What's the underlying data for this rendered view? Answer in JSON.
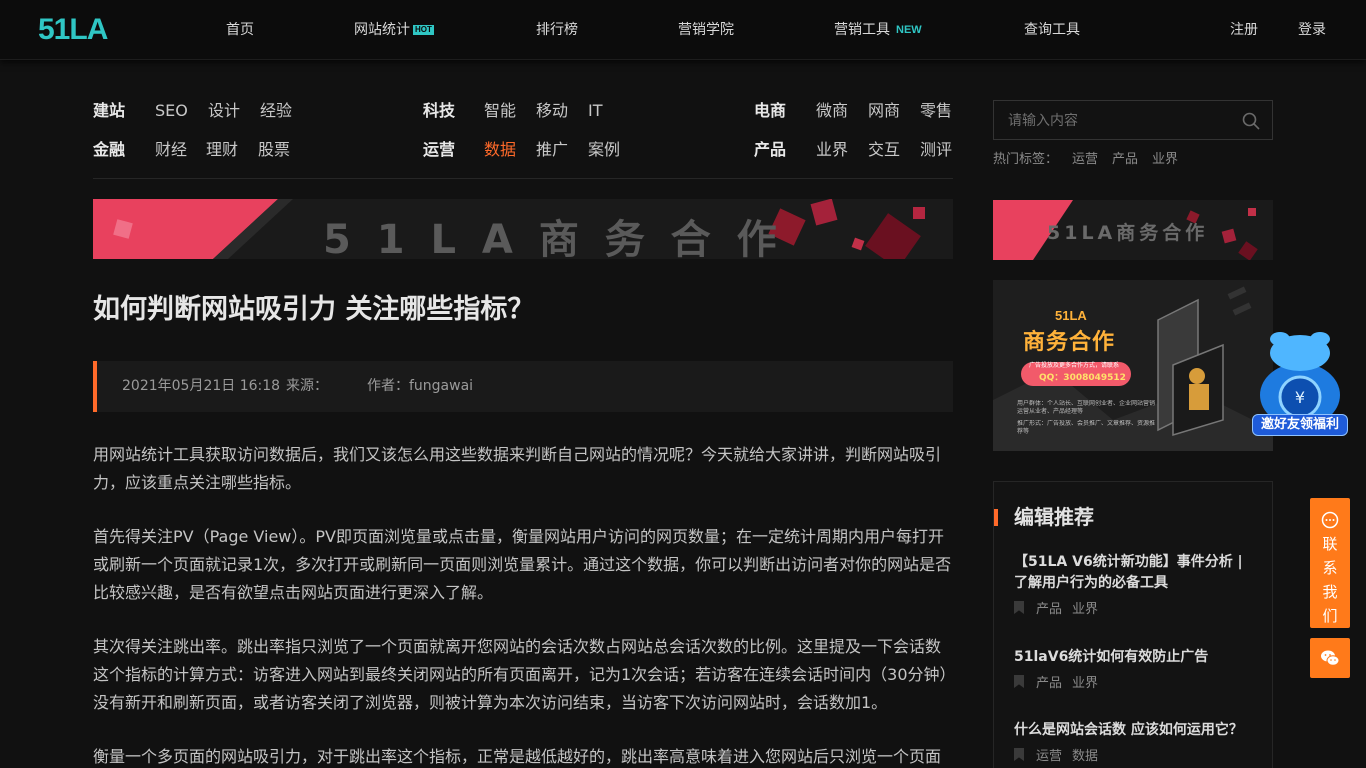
{
  "brand": {
    "logo": "51LA",
    "accent": "#2fc6c4",
    "highlight": "#ff6a2a"
  },
  "nav": {
    "items": [
      {
        "label": "首页"
      },
      {
        "label": "网站统计",
        "badge": "HOT"
      },
      {
        "label": "排行榜"
      },
      {
        "label": "营销学院"
      },
      {
        "label": "营销工具",
        "badge": "NEW"
      },
      {
        "label": "查询工具"
      }
    ],
    "register": "注册",
    "login": "登录"
  },
  "categories": {
    "build": {
      "head": "建站",
      "items": [
        "SEO",
        "设计",
        "经验"
      ]
    },
    "finance": {
      "head": "金融",
      "items": [
        "财经",
        "理财",
        "股票"
      ]
    },
    "tech": {
      "head": "科技",
      "items": [
        "智能",
        "移动",
        "IT"
      ]
    },
    "ops": {
      "head": "运营",
      "items": [
        "数据",
        "推广",
        "案例"
      ],
      "active": "数据"
    },
    "ecom": {
      "head": "电商",
      "items": [
        "微商",
        "网商",
        "零售"
      ]
    },
    "product": {
      "head": "产品",
      "items": [
        "业界",
        "交互",
        "测评"
      ]
    }
  },
  "banners": {
    "main": "5 1 L A 商 务 合 作",
    "side": "51LA商务合作"
  },
  "article": {
    "title": "如何判断网站吸引力 关注哪些指标？",
    "date": "2021年05月21日 16:18",
    "source_label": "来源：",
    "author_label": "作者：fungawai",
    "paragraphs": [
      "用网站统计工具获取访问数据后，我们又该怎么用这些数据来判断自己网站的情况呢？今天就给大家讲讲，判断网站吸引力，应该重点关注哪些指标。",
      "首先得关注PV（Page View）。PV即页面浏览量或点击量，衡量网站用户访问的网页数量；在一定统计周期内用户每打开或刷新一个页面就记录1次，多次打开或刷新同一页面则浏览量累计。通过这个数据，你可以判断出访问者对你的网站是否比较感兴趣，是否有欲望点击网站页面进行更深入了解。",
      "其次得关注跳出率。跳出率指只浏览了一个页面就离开您网站的会话次数占网站总会话次数的比例。这里提及一下会话数这个指标的计算方式：访客进入网站到最终关闭网站的所有页面离开，记为1次会话；若访客在连续会话时间内（30分钟）没有新开和刷新页面，或者访客关闭了浏览器，则被计算为本次访问结束，当访客下次访问网站时，会话数加1。",
      "衡量一个多页面的网站吸引力，对于跳出率这个指标，正常是越低越好的，跳出率高意味着进入您网站后只浏览一个页面"
    ]
  },
  "sidebar": {
    "search_placeholder": "请输入内容",
    "hot_tags_label": "热门标签：",
    "hot_tags": [
      "运营",
      "产品",
      "业界"
    ],
    "promo": {
      "brand": "51LA",
      "title": "商务合作",
      "line1": "广告投放及更多合作方式，请联系",
      "qq": "QQ：3008049512",
      "audience": "用户群体：个人站长、互联网创业者、企业网站营销运营从业者、产品经理等",
      "resources": "推广形式：广告投放、会员推广、文章推荐、资源推荐等"
    },
    "recommend_title": "编辑推荐",
    "recommend": [
      {
        "title": "【51LA V6统计新功能】事件分析 | 了解用户行为的必备工具",
        "tags": [
          "产品",
          "业界"
        ]
      },
      {
        "title": "51laV6统计如何有效防止广告",
        "tags": [
          "产品",
          "业界"
        ]
      },
      {
        "title": "什么是网站会话数 应该如何运用它？",
        "tags": [
          "运营",
          "数据"
        ]
      }
    ]
  },
  "floating": {
    "contact": "联系我们",
    "gift": "邀好友领福利"
  }
}
